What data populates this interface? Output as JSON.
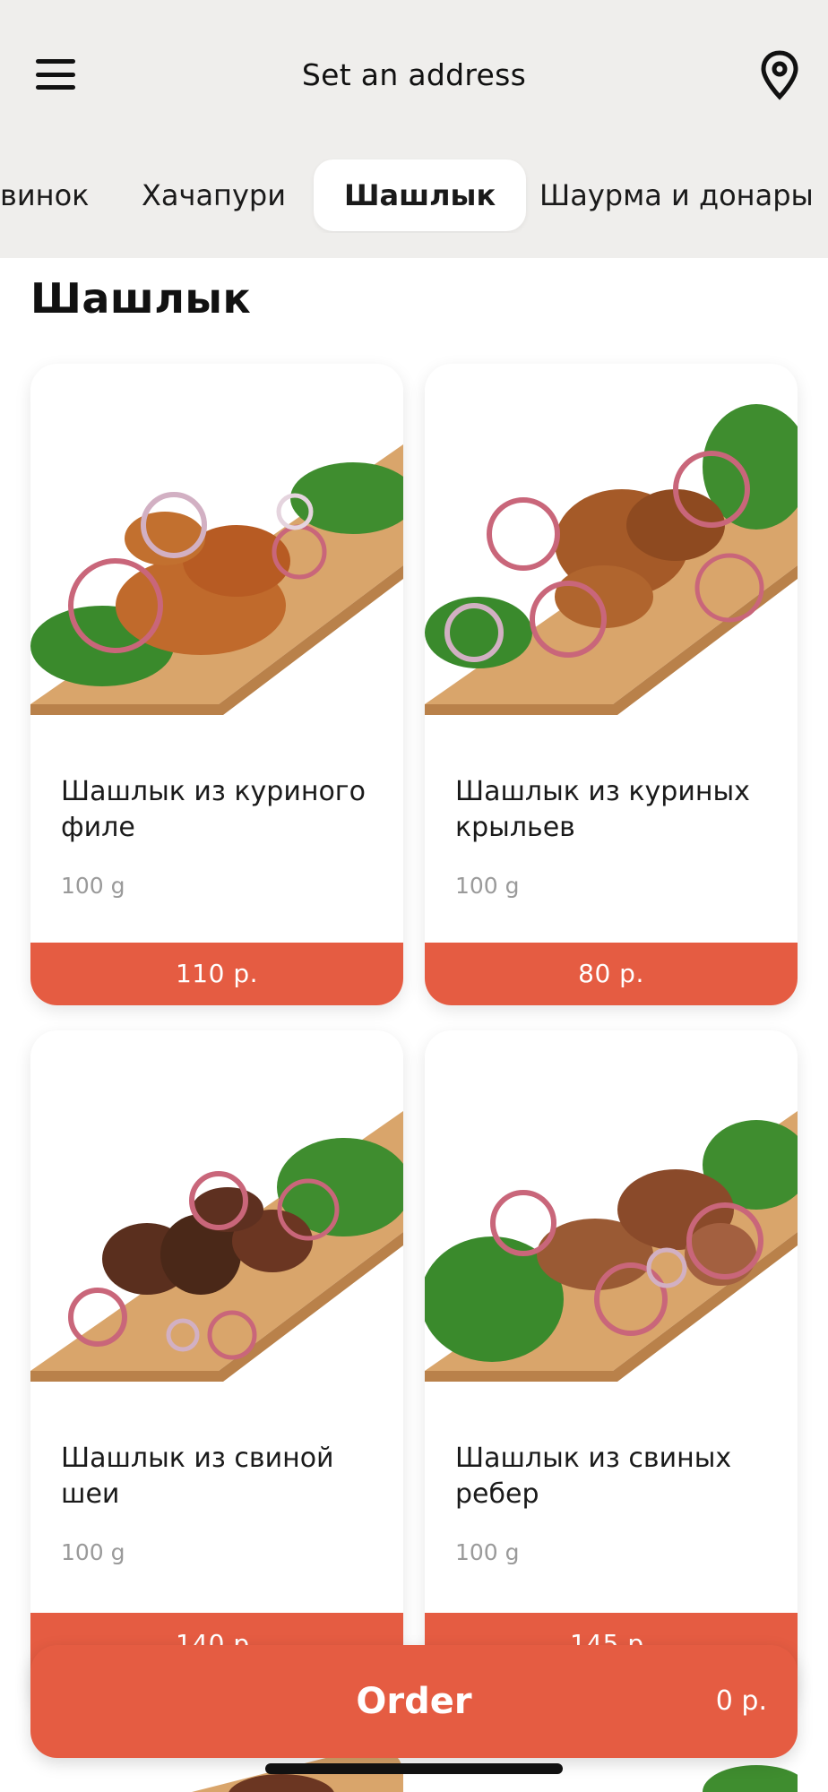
{
  "header": {
    "address_label": "Set an address"
  },
  "tabs": [
    {
      "label": "винок"
    },
    {
      "label": "Хачапури"
    },
    {
      "label": "Шашлык",
      "active": true
    },
    {
      "label": "Шаурма и донары"
    }
  ],
  "section": {
    "title": "Шашлык"
  },
  "products": [
    {
      "name": "Шашлык из куриного филе",
      "weight": "100 g",
      "price": "110 р."
    },
    {
      "name": "Шашлык из куриных крыльев",
      "weight": "100 g",
      "price": "80 р."
    },
    {
      "name": "Шашлык из свиной шеи",
      "weight": "100 g",
      "price": "140 р."
    },
    {
      "name": "Шашлык из свиных ребер",
      "weight": "100 g",
      "price": "145 р."
    }
  ],
  "order": {
    "label": "Order",
    "total": "0 р."
  },
  "colors": {
    "accent": "#e55c42",
    "header_bg": "#efeeec"
  },
  "icons": [
    "hamburger-menu-icon",
    "location-pin-icon"
  ]
}
